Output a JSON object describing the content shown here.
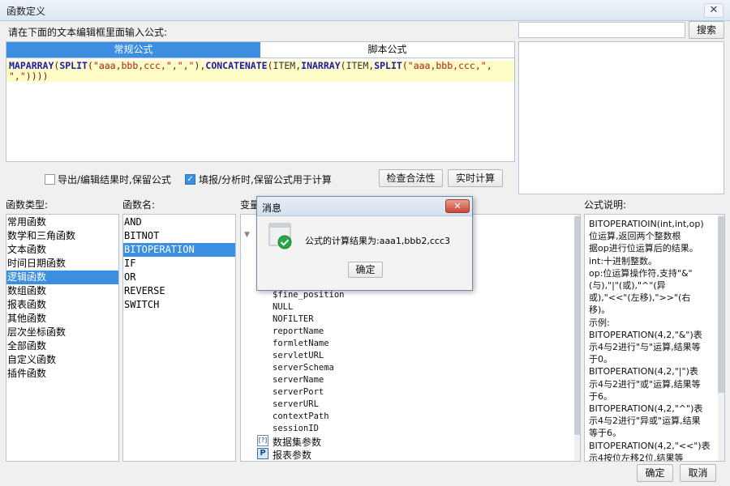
{
  "window": {
    "title": "函数定义",
    "close_glyph": "✕"
  },
  "prompt": "请在下面的文本编辑框里面输入公式:",
  "tabs": [
    {
      "label": "常规公式"
    },
    {
      "label": "脚本公式"
    }
  ],
  "editor": {
    "line1_tokens": [
      [
        "fn",
        "MAPARRAY"
      ],
      [
        "p",
        "("
      ],
      [
        "fn",
        "SPLIT"
      ],
      [
        "p",
        "("
      ],
      [
        "str",
        "\"aaa,bbb,ccc,\""
      ],
      [
        "p",
        ","
      ],
      [
        "str",
        "\",\""
      ],
      [
        "p",
        "),"
      ],
      [
        "fn",
        "CONCATENATE"
      ],
      [
        "p",
        "("
      ],
      [
        "id",
        "ITEM"
      ],
      [
        "p",
        ","
      ],
      [
        "fn",
        "INARRAY"
      ],
      [
        "p",
        "("
      ],
      [
        "id",
        "ITEM"
      ],
      [
        "p",
        ","
      ],
      [
        "fn",
        "SPLIT"
      ],
      [
        "p",
        "("
      ],
      [
        "str",
        "\"aaa,bbb,ccc,\""
      ],
      [
        "p",
        ","
      ]
    ],
    "line2_tokens": [
      [
        "str",
        "\",\""
      ],
      [
        "p",
        "))))"
      ]
    ]
  },
  "search": {
    "value": "",
    "button": "搜索"
  },
  "options": {
    "keep_formula_export": {
      "label": "导出/编辑结果时,保留公式",
      "checked": false
    },
    "keep_formula_fill": {
      "label": "填报/分析时,保留公式用于计算",
      "checked": true
    }
  },
  "buttons": {
    "check": "检查合法性",
    "realtime": "实时计算",
    "ok": "确定",
    "cancel": "取消"
  },
  "func_types": {
    "header": "函数类型:",
    "items": [
      "常用函数",
      "数学和三角函数",
      "文本函数",
      "时间日期函数",
      "逻辑函数",
      "数组函数",
      "报表函数",
      "其他函数",
      "层次坐标函数",
      "全部函数",
      "自定义函数",
      "插件函数"
    ],
    "selected_index": 4
  },
  "func_names": {
    "header": "函数名:",
    "items": [
      "AND",
      "BITNOT",
      "BITOPERATION",
      "IF",
      "OR",
      "REVERSE",
      "SWITCH"
    ],
    "selected_index": 2
  },
  "variables": {
    "header": "变量",
    "items": [
      "$fine_position",
      "NULL",
      "NOFILTER",
      "reportName",
      "formletName",
      "servletURL",
      "serverSchema",
      "serverName",
      "serverPort",
      "serverURL",
      "contextPath",
      "sessionID"
    ],
    "group_dataset": "数据集参数",
    "group_report": "报表参数"
  },
  "description": {
    "header": "公式说明:",
    "lines": [
      "BITOPERATIOIN(int,int,op)",
      "位运算,返回两个整数根",
      "据op进行位运算后的结果。",
      "int:十进制整数。",
      "op:位运算操作符,支持\"&\"",
      "(与),\"|\"(或),\"^\"(异",
      "或),\"<<\"(左移),\">>\"(右",
      "移)。",
      "示例:",
      "BITOPERATION(4,2,\"&\")表",
      "示4与2进行\"与\"运算,结果等",
      "于0。",
      "BITOPERATION(4,2,\"|\")表",
      "示4与2进行\"或\"运算,结果等",
      "于6。",
      "BITOPERATION(4,2,\"^\")表",
      "示4与2进行\"异或\"运算,结果",
      "等于6。",
      "BITOPERATION(4,2,\"<<\")表",
      "示4按位左移2位,结果等"
    ]
  },
  "dialog": {
    "title": "消息",
    "message": "公式的计算结果为:aaa1,bbb2,ccc3",
    "ok": "确定",
    "close_glyph": "✕"
  }
}
